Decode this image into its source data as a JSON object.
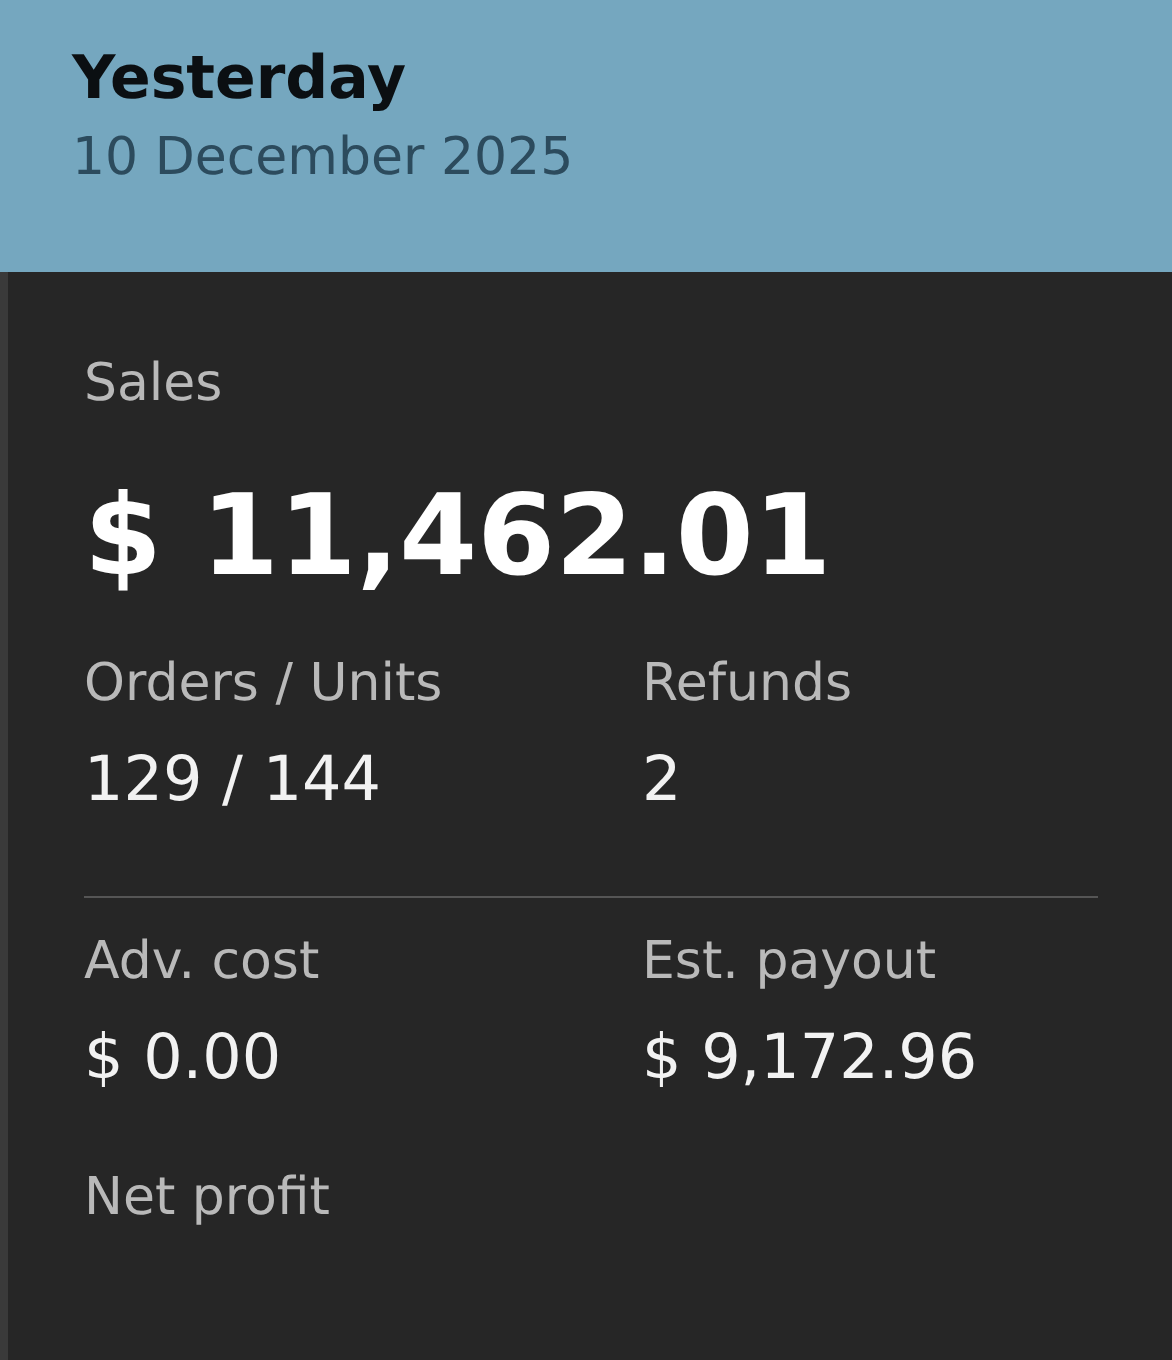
{
  "header": {
    "title": "Yesterday",
    "date": "10 December 2025"
  },
  "sales": {
    "label": "Sales",
    "value": "$ 11,462.01"
  },
  "metrics_top": [
    {
      "label": "Orders / Units",
      "value": "129 / 144"
    },
    {
      "label": "Refunds",
      "value": "2"
    }
  ],
  "metrics_bottom": [
    {
      "label": "Adv. cost",
      "value": "$ 0.00"
    },
    {
      "label": "Est. payout",
      "value": "$ 9,172.96"
    },
    {
      "label": "Net profit"
    }
  ]
}
